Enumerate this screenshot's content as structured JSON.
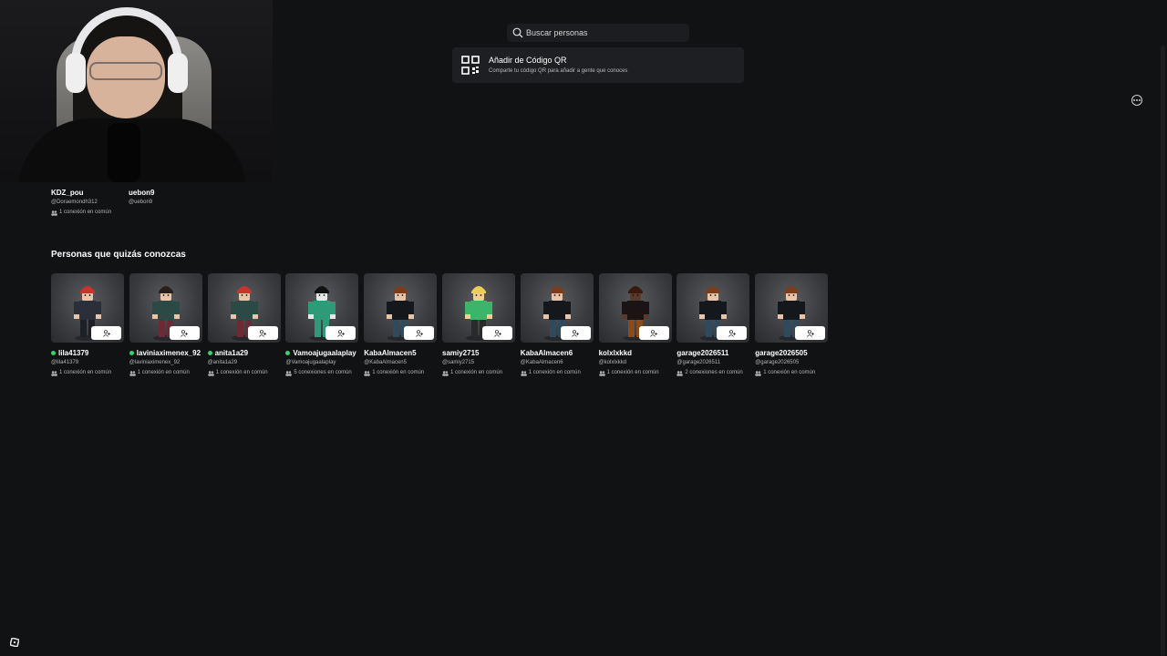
{
  "search": {
    "placeholder": "Buscar personas"
  },
  "qr": {
    "title": "Añadir de Código QR",
    "subtitle": "Comparte tu código QR para añadir a gente que conoces"
  },
  "connections": [
    {
      "name": "KDZ_pou",
      "handle": "@Doraemondh312",
      "mutual": "1 conexión en común"
    },
    {
      "name": "uebon9",
      "handle": "@uebon9",
      "mutual": ""
    }
  ],
  "suggestions_title": "Personas que quizás conozcas",
  "suggestions": [
    {
      "name": "lila41379",
      "handle": "@lila41379",
      "mutual": "1 conexión en común",
      "online": true,
      "hair": "#c8352e",
      "shirt": "#2a2f3a",
      "pants": "#1d2026",
      "skin": "#e8c4a8"
    },
    {
      "name": "laviniaximenex_92",
      "handle": "@laviniaximenex_92",
      "mutual": "1 conexión en común",
      "online": true,
      "hair": "#2a1f1a",
      "shirt": "#2b4a46",
      "pants": "#6b2a36",
      "skin": "#e8c4a8"
    },
    {
      "name": "anita1a29",
      "handle": "@anita1a29",
      "mutual": "1 conexión en común",
      "online": true,
      "hair": "#c8352e",
      "shirt": "#2b4a46",
      "pants": "#6b2a36",
      "skin": "#e8c4a8"
    },
    {
      "name": "Vamoajugaalaplay",
      "handle": "@Vamoajugaalaplay",
      "mutual": "5 conexiones en común",
      "online": true,
      "hair": "#111111",
      "shirt": "#2f9a78",
      "pants": "#2f9a78",
      "skin": "#e8e8e8"
    },
    {
      "name": "KabaAlmacen5",
      "handle": "@KabaAlmacen5",
      "mutual": "1 conexión en común",
      "online": false,
      "hair": "#7a3e1e",
      "shirt": "#14171c",
      "pants": "#2f4a5c",
      "skin": "#e8c4a8"
    },
    {
      "name": "samiy2715",
      "handle": "@samiy2715",
      "mutual": "1 conexión en común",
      "online": false,
      "hair": "#e9cf5a",
      "shirt": "#3ab56a",
      "pants": "#2a2a2a",
      "skin": "#f0d090"
    },
    {
      "name": "KabaAlmacen6",
      "handle": "@KabaAlmacen6",
      "mutual": "1 conexión en común",
      "online": false,
      "hair": "#7a3e1e",
      "shirt": "#14171c",
      "pants": "#2f4a5c",
      "skin": "#e8c4a8"
    },
    {
      "name": "kolxlxkkd",
      "handle": "@kolxlxkkd",
      "mutual": "1 conexión en común",
      "online": false,
      "hair": "#3a1a10",
      "shirt": "#1a1414",
      "pants": "#8a4a1a",
      "skin": "#5a3a2a"
    },
    {
      "name": "garage2026511",
      "handle": "@garage2026511",
      "mutual": "2 conexiones en común",
      "online": false,
      "hair": "#7a3e1e",
      "shirt": "#14171c",
      "pants": "#2f4a5c",
      "skin": "#e8c4a8"
    },
    {
      "name": "garage2026505",
      "handle": "@garage2026505",
      "mutual": "1 conexión en común",
      "online": false,
      "hair": "#7a3e1e",
      "shirt": "#14171c",
      "pants": "#2f4a5c",
      "skin": "#e8c4a8"
    }
  ]
}
